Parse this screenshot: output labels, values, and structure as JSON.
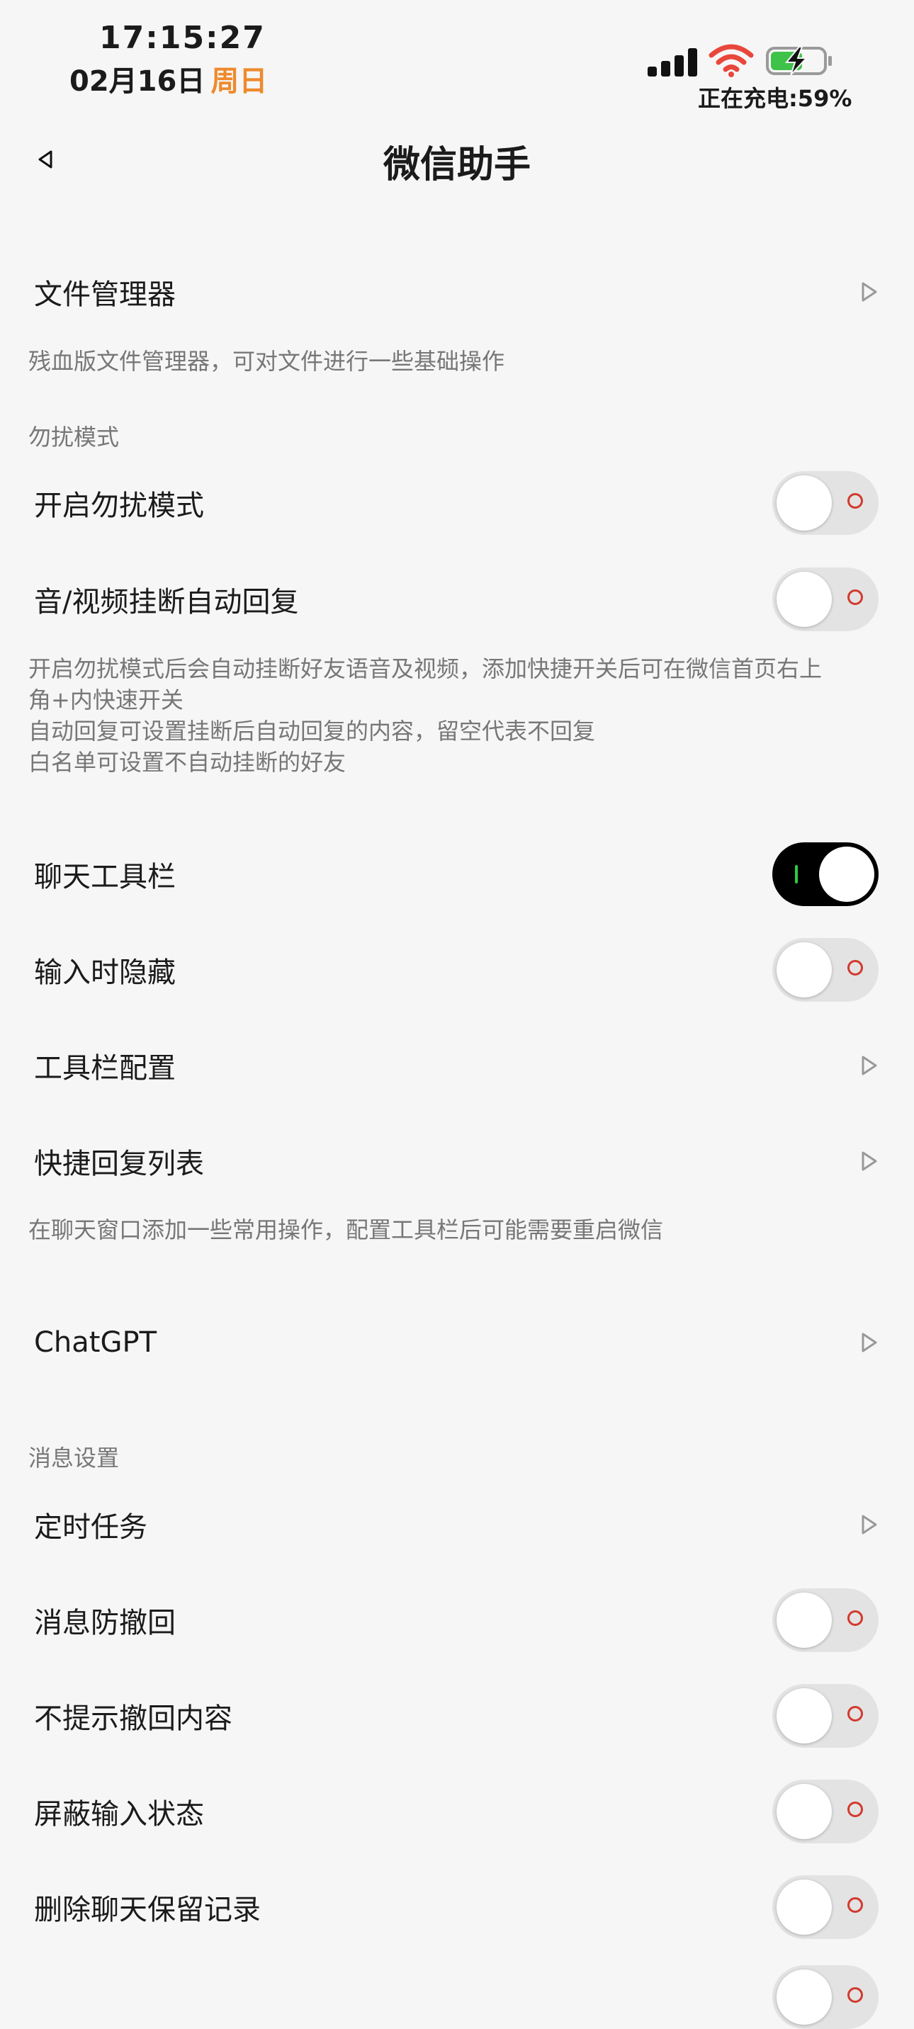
{
  "status_bar": {
    "time": "17:15:27",
    "date": "02月16日",
    "weekday": "周日",
    "charging": "正在充电:59%"
  },
  "header": {
    "title": "微信助手"
  },
  "rows": {
    "file_manager": "文件管理器",
    "dnd_mode": "开启勿扰模式",
    "auto_reply": "音/视频挂断自动回复",
    "chat_toolbar": "聊天工具栏",
    "hide_on_input": "输入时隐藏",
    "toolbar_config": "工具栏配置",
    "quick_reply": "快捷回复列表",
    "chatgpt": "ChatGPT",
    "scheduled_task": "定时任务",
    "anti_revoke": "消息防撤回",
    "no_revoke_hint": "不提示撤回内容",
    "block_typing": "屏蔽输入状态",
    "delete_keep_record": "删除聊天保留记录"
  },
  "descriptions": {
    "file_manager": "残血版文件管理器，可对文件进行一些基础操作",
    "dnd_line1": "开启勿扰模式后会自动挂断好友语音及视频，添加快捷开关后可在微信首页右上",
    "dnd_line2": "角+内快速开关",
    "dnd_line3": "自动回复可设置挂断后自动回复的内容，留空代表不回复",
    "dnd_line4": "白名单可设置不自动挂断的好友",
    "toolbar": "在聊天窗口添加一些常用操作，配置工具栏后可能需要重启微信"
  },
  "sections": {
    "dnd": "勿扰模式",
    "message": "消息设置"
  },
  "toggles": {
    "dnd_mode": false,
    "auto_reply": false,
    "chat_toolbar": true,
    "hide_on_input": false,
    "anti_revoke": false,
    "no_revoke_hint": false,
    "block_typing": false,
    "delete_keep_record": false
  }
}
